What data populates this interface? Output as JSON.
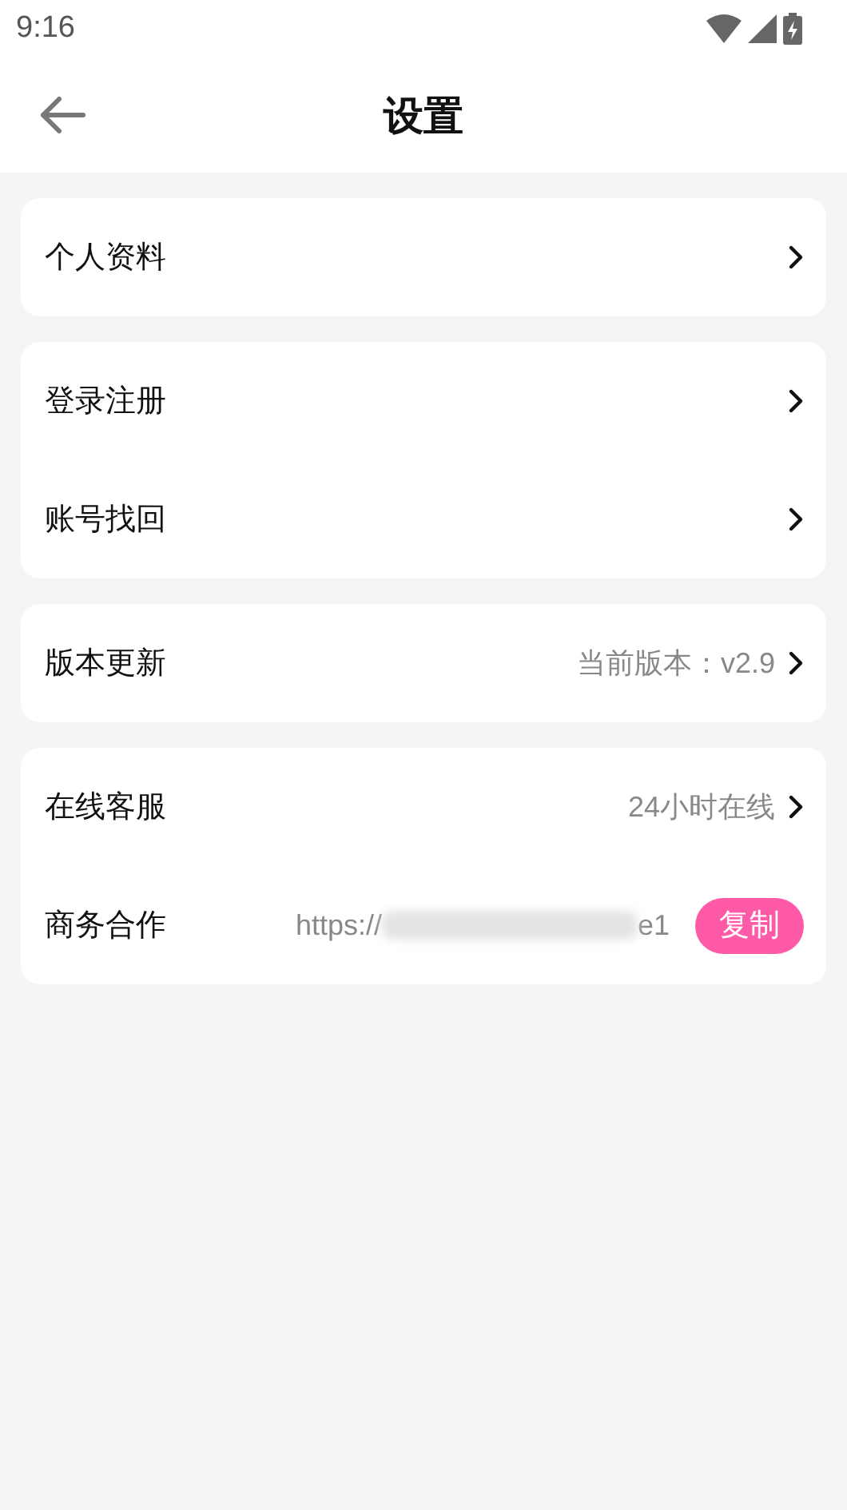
{
  "status_bar": {
    "time": "9:16"
  },
  "header": {
    "title": "设置"
  },
  "groups": [
    {
      "rows": [
        {
          "kind": "link",
          "label": "个人资料"
        }
      ]
    },
    {
      "rows": [
        {
          "kind": "link",
          "label": "登录注册"
        },
        {
          "kind": "link",
          "label": "账号找回"
        }
      ]
    },
    {
      "rows": [
        {
          "kind": "link",
          "label": "版本更新",
          "value": "当前版本：v2.9"
        }
      ]
    },
    {
      "rows": [
        {
          "kind": "link",
          "label": "在线客服",
          "value": "24小时在线"
        },
        {
          "kind": "copy",
          "label": "商务合作",
          "url_start": "https://",
          "url_end": "e1",
          "button": "复制"
        }
      ]
    }
  ]
}
